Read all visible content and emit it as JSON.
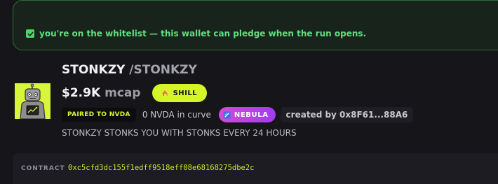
{
  "banner": {
    "text": "you're on the whitelist — this wallet can pledge when the run opens.",
    "accent_color": "#4fd46b",
    "icon": "checkbox-checked-icon"
  },
  "token": {
    "name": "STONKZY",
    "ticker": "/STONKZY",
    "avatar_icon": "robot-with-chart-avatar",
    "mcap_value": "$2.9K",
    "mcap_unit": "mcap",
    "shill_label": "SHILL",
    "pair_badge": "PAIRED TO NVDA",
    "curve_text": "0 NVDA in curve",
    "platform_label": "NEBULA",
    "created_by": "created by 0x8F61...88A6",
    "description": "STONKZY STONKS YOU WITH STONKS EVERY 24 HOURS"
  },
  "contract": {
    "label": "CONTRACT",
    "address": "0xc5cfd3dc155f1edff9518eff08e68168275dbe2c"
  },
  "colors": {
    "background": "#161519",
    "brand_lime": "#d6f42a",
    "nebula_gradient": [
      "#d34ad6",
      "#a23cf0"
    ]
  }
}
